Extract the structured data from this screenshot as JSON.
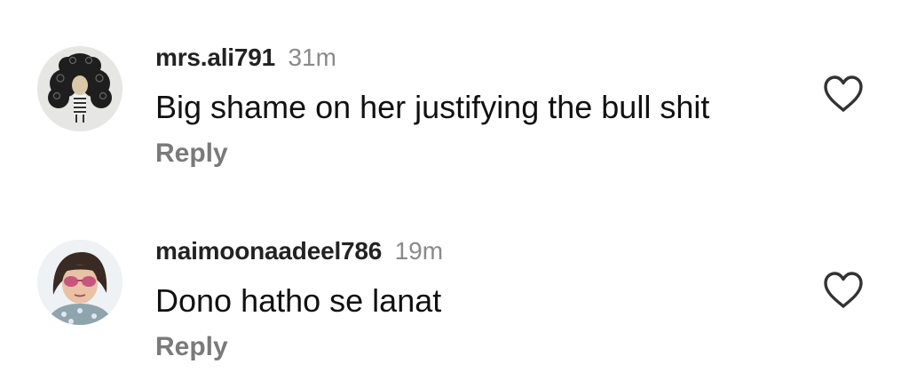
{
  "comments": [
    {
      "username": "mrs.ali791",
      "time": "31m",
      "text": "Big shame on her justifying the bull shit",
      "reply_label": "Reply",
      "avatar_icon": "curly-hair-doll-avatar",
      "like_icon": "heart-outline-icon"
    },
    {
      "username": "maimoonaadeel786",
      "time": "19m",
      "text": "Dono hatho se lanat",
      "reply_label": "Reply",
      "avatar_icon": "girl-with-pink-sunglasses-avatar",
      "like_icon": "heart-outline-icon"
    }
  ],
  "colors": {
    "username": "#222222",
    "timestamp": "#8a8a8a",
    "reply": "#7a7a7a",
    "heart_stroke": "#333333"
  }
}
